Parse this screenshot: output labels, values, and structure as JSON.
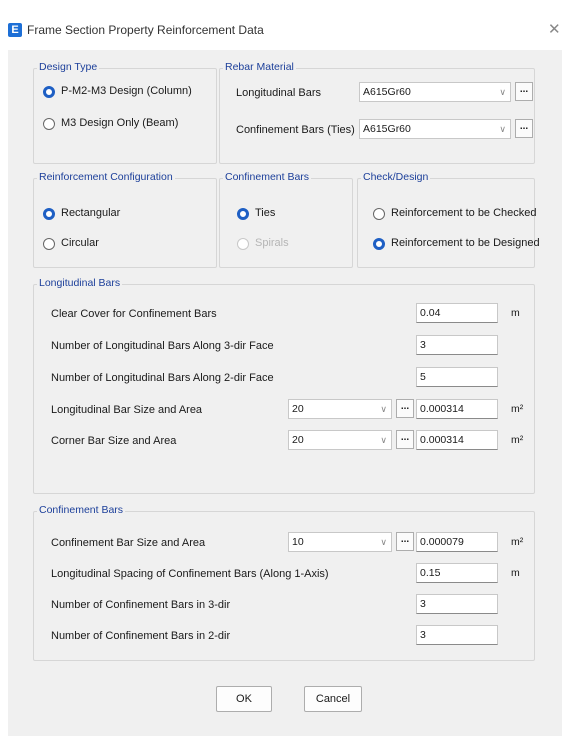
{
  "window": {
    "icon_letter": "E",
    "title": "Frame Section Property Reinforcement Data",
    "close": "✕"
  },
  "design_type": {
    "legend": "Design Type",
    "options": [
      "P-M2-M3 Design  (Column)",
      "M3 Design Only  (Beam)"
    ],
    "selected": 0
  },
  "rebar_material": {
    "legend": "Rebar Material",
    "longitudinal_label": "Longitudinal Bars",
    "longitudinal_value": "A615Gr60",
    "confinement_label": "Confinement Bars (Ties)",
    "confinement_value": "A615Gr60",
    "more": "..."
  },
  "reinforcement_config": {
    "legend": "Reinforcement Configuration",
    "options": [
      "Rectangular",
      "Circular"
    ],
    "selected": 0
  },
  "confinement_type": {
    "legend": "Confinement Bars",
    "options": [
      "Ties",
      "Spirals"
    ],
    "selected": 0
  },
  "check_design": {
    "legend": "Check/Design",
    "options": [
      "Reinforcement to be Checked",
      "Reinforcement to be Designed"
    ],
    "selected": 1
  },
  "longitudinal_bars": {
    "legend": "Longitudinal Bars",
    "clear_cover_label": "Clear Cover for Confinement Bars",
    "clear_cover_value": "0.04",
    "clear_cover_unit": "m",
    "num_3dir_label": "Number of Longitudinal Bars Along 3-dir Face",
    "num_3dir_value": "3",
    "num_2dir_label": "Number of Longitudinal Bars Along 2-dir Face",
    "num_2dir_value": "5",
    "bar_size_label": "Longitudinal Bar Size and Area",
    "bar_size_value": "20",
    "bar_area_value": "0.000314",
    "corner_label": "Corner Bar Size and Area",
    "corner_size_value": "20",
    "corner_area_value": "0.000314",
    "area_unit": "m²",
    "more": "..."
  },
  "confinement_bars": {
    "legend": "Confinement Bars",
    "bar_size_label": "Confinement Bar Size and Area",
    "bar_size_value": "10",
    "bar_area_value": "0.000079",
    "area_unit": "m²",
    "spacing_label": "Longitudinal Spacing of Confinement Bars  (Along 1-Axis)",
    "spacing_value": "0.15",
    "spacing_unit": "m",
    "num_3dir_label": "Number of Confinement Bars in 3-dir",
    "num_3dir_value": "3",
    "num_2dir_label": "Number of Confinement Bars in 2-dir",
    "num_2dir_value": "3",
    "more": "..."
  },
  "buttons": {
    "ok": "OK",
    "cancel": "Cancel"
  }
}
